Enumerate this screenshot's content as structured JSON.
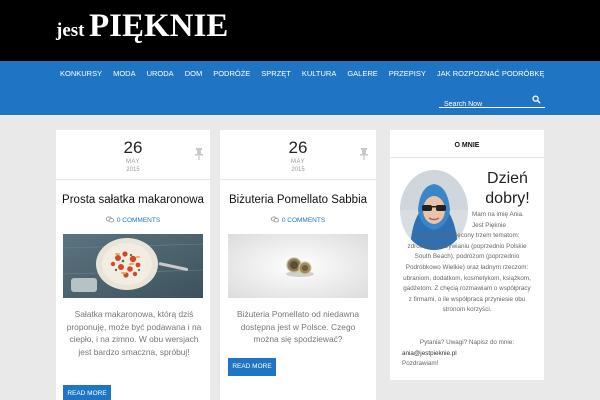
{
  "header": {
    "logo_small": "jest",
    "logo_big": "PIĘKNIE"
  },
  "nav": {
    "items": [
      "KONKURSY",
      "MODA",
      "URODA",
      "DOM",
      "PODRÓŻE",
      "SPRZĘT",
      "KULTURA",
      "GALERE",
      "PRZEPISY",
      "JAK ROZPOZNAĆ PODRÓBKĘ"
    ],
    "search_placeholder": "Search Now"
  },
  "posts": [
    {
      "day": "26",
      "month": "MAY",
      "year": "2015",
      "title": "Prosta sałatka makaronowa",
      "comments": "0 COMMENTS",
      "excerpt": "Sałatka makaronowa, którą dziś proponuję, może być podawana i na ciepło, i na zimno. W obu wersjach jest bardzo smaczna, spróbuj!",
      "read_more": "READ MORE"
    },
    {
      "day": "26",
      "month": "MAY",
      "year": "2015",
      "title": "Biżuteria Pomellato Sabbia",
      "comments": "0 COMMENTS",
      "excerpt": "Biżuteria Pomellato od niedawna dostępna jest w Polsce. Czego można się spodziewać?",
      "read_more": "READ MORE"
    }
  ],
  "about": {
    "title": "O MNIE",
    "greeting": "Dzień dobry!",
    "text_lead": "Mam na imię Ania. Jest Pięknie",
    "text_body": "to serwis poświęcony trzem tematom: zdrowemu odżywianiu (poprzednio Polskie South Beach), podróżom (poprzednio Podróbkowo Wielkie) oraz ładnym rzeczom: ubraniom, dodatkom, kosmetykom, książkom, gadżetom. Z chęcią rozmawiam o współpracy z firmami, o ile współpraca przyniesie obu stronom korzyści.",
    "contact": "Pytania? Uwagi? Napisz do mnie:",
    "email": "ania@jestpieknie.pl",
    "sign_off": "Pozdrawiam!"
  },
  "colors": {
    "accent": "#1f74c4",
    "topbar": "#000000",
    "background": "#e9e9e9"
  }
}
